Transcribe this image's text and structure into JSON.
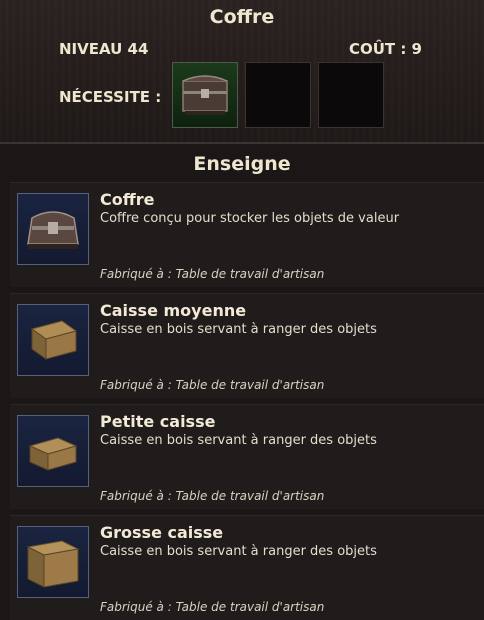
{
  "header": {
    "title": "Coffre",
    "level": "NIVEAU 44",
    "cost": "COÛT : 9",
    "requires_label": "NÉCESSITE :"
  },
  "required_slots": [
    {
      "icon": "chest-icon",
      "filled": true
    },
    {
      "icon": "",
      "filled": false
    },
    {
      "icon": "",
      "filled": false
    }
  ],
  "section": {
    "title": "Enseigne"
  },
  "items": [
    {
      "name": "Coffre",
      "description": "Coffre conçu pour stocker les objets de valeur",
      "crafted_at": "Fabriqué à : Table de travail d'artisan",
      "icon": "ornate-chest-icon"
    },
    {
      "name": "Caisse moyenne",
      "description": "Caisse en bois servant à ranger des objets",
      "crafted_at": "Fabriqué à : Table de travail d'artisan",
      "icon": "medium-crate-icon"
    },
    {
      "name": "Petite caisse",
      "description": "Caisse en bois servant à ranger des objets",
      "crafted_at": "Fabriqué à : Table de travail d'artisan",
      "icon": "small-crate-icon"
    },
    {
      "name": "Grosse caisse",
      "description": "Caisse en bois servant à ranger des objets",
      "crafted_at": "Fabriqué à : Table de travail d'artisan",
      "icon": "large-crate-icon"
    }
  ]
}
